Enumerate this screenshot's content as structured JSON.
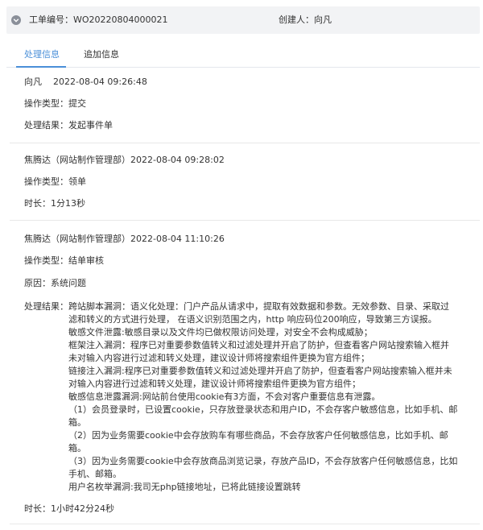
{
  "header": {
    "ticket_label": "工单编号：",
    "ticket_value": "WO20220804000021",
    "creator_label": "创建人：",
    "creator_value": "向凡"
  },
  "tabs": [
    {
      "label": "处理信息",
      "active": true
    },
    {
      "label": "追加信息",
      "active": false
    }
  ],
  "records": [
    {
      "person": "向凡",
      "time": "2022-08-04 09:26:48",
      "op_label": "操作类型：",
      "op_value": "提交",
      "result_label": "处理结果：",
      "result_value": "发起事件单"
    },
    {
      "person": "焦腾达（网站制作管理部）",
      "time": "2022-08-04 09:28:02",
      "op_label": "操作类型：",
      "op_value": "领单",
      "dur_label": "时长：",
      "dur_value": "1分13秒"
    },
    {
      "person": "焦腾达（网站制作管理部）",
      "time": "2022-08-04 11:10:26",
      "op_label": "操作类型：",
      "op_value": "结单审核",
      "reason_label": "原因：",
      "reason_value": "系统问题",
      "result_label": "处理结果：",
      "result_lines": [
        "跨站脚本漏洞：语义化处理：门户产品从请求中，提取有效数据和参数。无效参数、目录、采取过",
        "滤和转义的方式进行处理，  在语义识别范围之内，http 响应码位200响应，导致第三方误报。",
        "敏感文件泄露:敏感目录以及文件均已做权限访问处理，对安全不会构成威胁；",
        "框架注入漏洞：程序已对重要参数值转义和过滤处理并开启了防护，但查看客户网站搜索输入框并",
        "未对输入内容进行过滤和转义处理，建议设计师将搜索组件更换为官方组件；",
        "链接注入漏洞:程序已对重要参数值转义和过滤处理并开启了防护，但查看客户网站搜索输入框并未",
        "对输入内容进行过滤和转义处理，建议设计师将搜索组件更换为官方组件；",
        "敏感信息泄露漏洞:网站前台使用cookie有3方面，不会对客户重要信息有泄露。",
        "  （1）会员登录时，已设置cookie，只存放登录状态和用户ID，不会存客户敏感信息，比如手机、邮",
        "  箱。",
        "  （2）因为业务需要cookie中会存放购车有哪些商品，不会存放客户任何敏感信息，比如手机、邮",
        "  箱。",
        "  （3）因为业务需要cookie中会存放商品浏览记录，存放产品ID，不会存放客户任何敏感信息，比如",
        "  手机、邮箱。",
        "  用户名枚举漏洞:我司无php链接地址，已将此链接设置跳转"
      ],
      "dur_label": "时长：",
      "dur_value": "1小时42分24秒"
    }
  ],
  "colors": {
    "accent": "#4a8fd8",
    "header_bg": "#f2f3f5",
    "divider": "#e8e8e8"
  }
}
